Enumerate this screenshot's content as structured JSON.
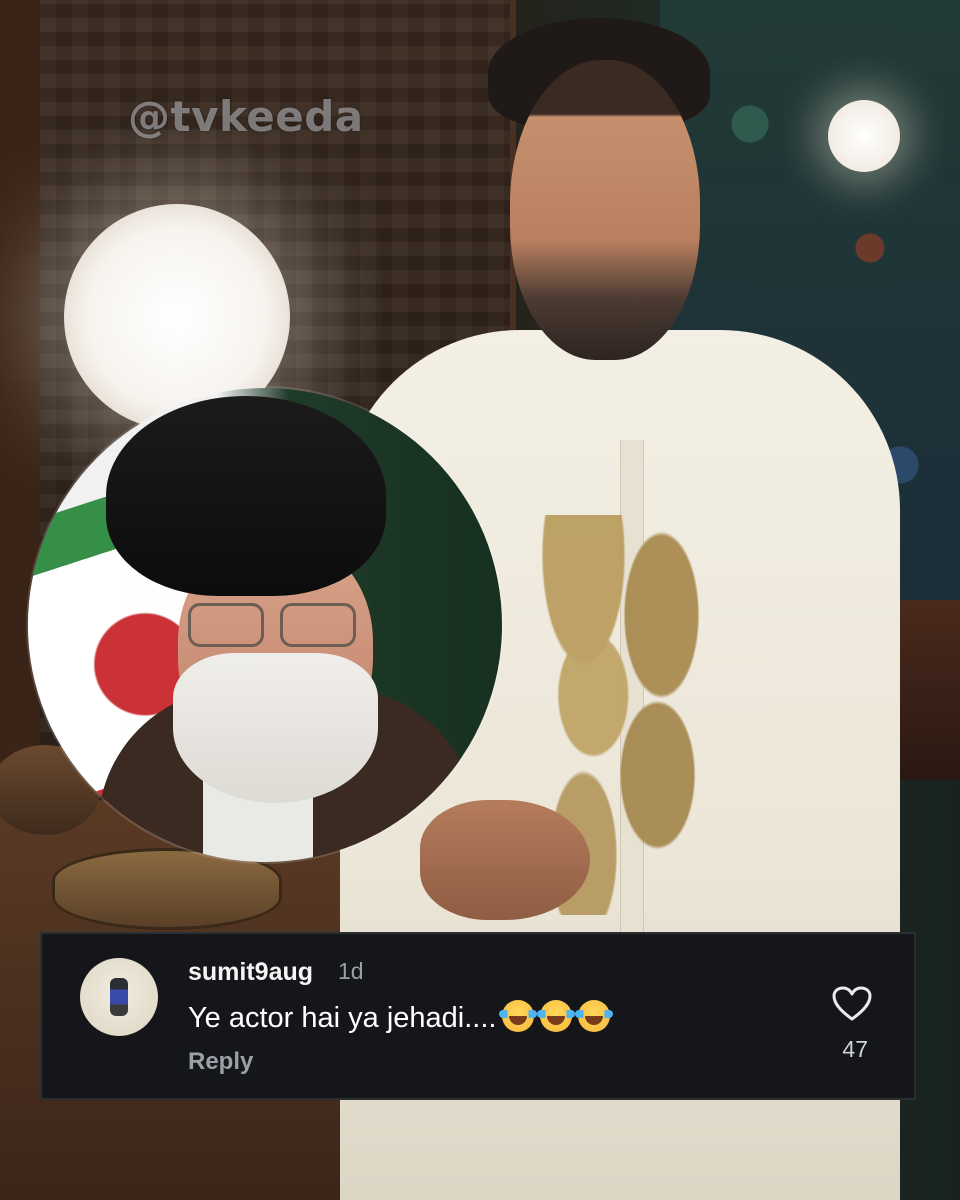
{
  "watermark": "@tvkeeda",
  "comment": {
    "username": "sumit9aug",
    "time": "1d",
    "text": "Ye actor hai ya jehadi....",
    "emoji_count": 3,
    "emoji_icon": "face-with-tears-of-joy-icon",
    "reply_label": "Reply",
    "likes": "47",
    "like_icon": "heart-outline-icon"
  }
}
